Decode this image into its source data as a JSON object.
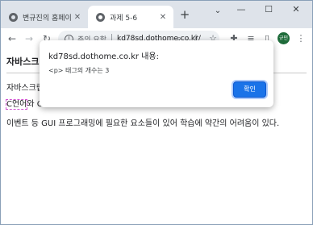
{
  "tabs": [
    {
      "title": "변규진의 홈페이지",
      "active": false
    },
    {
      "title": "과제 5-6",
      "active": true
    }
  ],
  "tabstrip": {
    "new_tab": "+",
    "tab_search": "⌄"
  },
  "window_controls": {
    "minimize": "—",
    "maximize": "☐",
    "close": "✕"
  },
  "toolbar": {
    "security_warning": "주의 요함",
    "url": "kd78sd.dothome.co.kr/",
    "profile_label": "규민"
  },
  "page": {
    "heading": "자바스크립트",
    "line1": "자바스크립",
    "line2_highlight": "C언어",
    "line2_rest": "와 C",
    "line3": "이벤트 등 GUI 프로그래밍에 필요한 요소들이 있어 학습에 약간의 어려움이 있다."
  },
  "dialog": {
    "title": "kd78sd.dothome.co.kr 내용:",
    "message": "<p> 태그의 개수는 3",
    "ok_label": "확인"
  },
  "colors": {
    "tabstrip": "#dee3ea",
    "accent": "#1a73e8",
    "avatar": "#1e6b3a"
  }
}
